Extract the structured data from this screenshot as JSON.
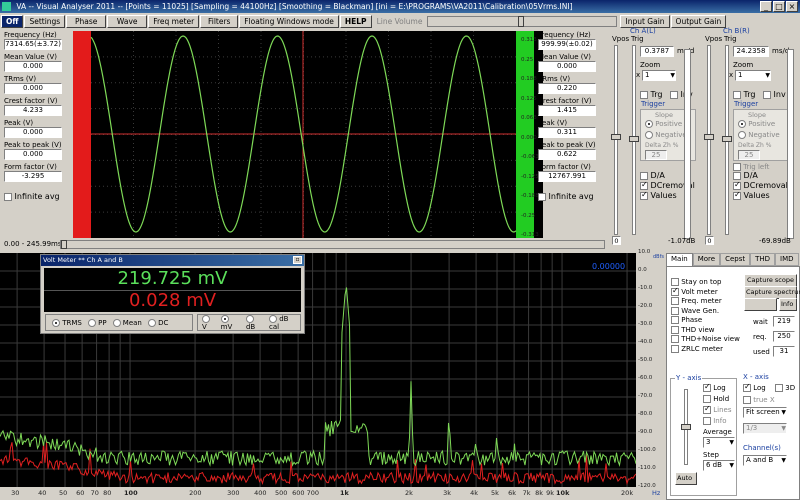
{
  "title_bar": {
    "text": "VA -- Visual Analyser 2011 --   [Points = 11025]   [Sampling = 44100Hz]   [Smoothing = Blackman]   [ini = E:\\PROGRAMS\\VA2011\\Calibration\\05Vrms.INI]"
  },
  "toolbar": {
    "off": "Off",
    "settings": "Settings",
    "phase": "Phase",
    "wave": "Wave",
    "freq_meter": "Freq meter",
    "filters": "Filters",
    "floating": "Floating Windows mode",
    "help": "HELP",
    "line_volume": "Line Volume",
    "input_gain": "Input Gain",
    "output_gain": "Output Gain"
  },
  "left_panel": {
    "frequency_label": "Frequency (Hz)",
    "frequency_value": "7314.65(±3.72)",
    "mean_label": "Mean Value (V)",
    "mean_value": "0.000",
    "trms_label": "TRms (V)",
    "trms_value": "0.000",
    "crest_label": "Crest factor (V)",
    "crest_value": "4.233",
    "peak_label": "Peak (V)",
    "peak_value": "0.000",
    "p2p_label": "Peak to peak (V)",
    "p2p_value": "0.000",
    "form_label": "Form factor (V)",
    "form_value": "-3.295",
    "infinite_avg": "Infinite avg"
  },
  "right_panel": {
    "frequency_label": "Frequency (Hz)",
    "frequency_value": "999.99(±0.02)",
    "mean_label": "Mean Value (V)",
    "mean_value": "0.000",
    "trms_label": "TRms (V)",
    "trms_value": "0.220",
    "crest_label": "Crest factor (V)",
    "crest_value": "1.415",
    "peak_label": "Peak (V)",
    "peak_value": "0.311",
    "p2p_label": "Peak to peak (V)",
    "p2p_value": "0.622",
    "form_label": "Form factor (V)",
    "form_value": "12767.991",
    "infinite_avg": "Infinite avg"
  },
  "scope": {
    "ticks": [
      "0.313",
      "0.25",
      "0.188",
      "0.125",
      "0.063",
      "0.000",
      "-0.063",
      "-0.125",
      "-0.188",
      "-0.25",
      "-0.313"
    ],
    "time_range": "0.00 - 245.99ms"
  },
  "channel_a": {
    "title": "Ch A(L)",
    "vpos": "Vpos",
    "trig": "Trig",
    "ms_div_value": "0.3787",
    "ms_div_unit": "ms/d",
    "zoom_label": "Zoom",
    "zoom_value": "1",
    "zoom_unit": "x",
    "trg": "Trg",
    "inv": "Inv",
    "trigger": "Trigger",
    "slope": "Slope",
    "positive": "Positive",
    "negative": "Negative",
    "delta": "Delta Zh %",
    "delta_value": "25",
    "da": "D/A",
    "dcremoval": "DCremoval",
    "values": "Values",
    "zero": "0",
    "db": "-1.07dB"
  },
  "channel_b": {
    "title": "Ch B(R)",
    "vpos": "Vpos",
    "trig": "Trig",
    "ms_div_value": "24.2358",
    "ms_div_unit": "ms/d",
    "zoom_label": "Zoom",
    "zoom_value": "1",
    "zoom_unit": "x",
    "trg": "Trg",
    "inv": "Inv",
    "trigger": "Trigger",
    "slope": "Slope",
    "positive": "Positive",
    "negative": "Negative",
    "trig_left": "Trig left",
    "delta": "Delta Zh %",
    "delta_value": "25",
    "da": "D/A",
    "dcremoval": "DCremoval",
    "values": "Values",
    "zero": "0",
    "db": "-69.89dB"
  },
  "voltmeter": {
    "title": "Volt Meter ** Ch A and B",
    "value_a": "219.725 mV",
    "value_b": "0.028 mV",
    "modes": [
      "TRMS",
      "PP",
      "Mean",
      "DC"
    ],
    "units": [
      "V",
      "mV",
      "dB",
      "dB cal"
    ]
  },
  "spectrum": {
    "readout": "0.00000",
    "db_ticks": [
      "10.0",
      "0.0",
      "-10.0",
      "-20.0",
      "-30.0",
      "-40.0",
      "-50.0",
      "-60.0",
      "-70.0",
      "-80.0",
      "-90.0",
      "-100.0",
      "-110.0",
      "-120.0"
    ],
    "freq_ticks": [
      "30",
      "40",
      "50",
      "60",
      "70",
      "80",
      "100",
      "200",
      "300",
      "400",
      "500",
      "600",
      "700",
      "1k",
      "2k",
      "3k",
      "4k",
      "5k",
      "6k",
      "7k",
      "8k",
      "9k",
      "10k",
      "20k"
    ],
    "db_unit": "dBfs",
    "hz_unit": "Hz"
  },
  "side_tabs": [
    "Main",
    "More",
    "Cepst",
    "THD",
    "IMD"
  ],
  "main_tab": {
    "checkboxes": [
      {
        "label": "Stay on top",
        "on": false
      },
      {
        "label": "Volt meter",
        "on": true
      },
      {
        "label": "Freq. meter",
        "on": false
      },
      {
        "label": "Wave Gen.",
        "on": false
      },
      {
        "label": "Phase",
        "on": false
      },
      {
        "label": "THD view",
        "on": false
      },
      {
        "label": "THD+Noise view",
        "on": false
      },
      {
        "label": "ZRLC meter",
        "on": false
      }
    ],
    "capture_scope": "Capture scope",
    "capture_spectrum": "Capture spectrum",
    "info": "Info",
    "wait_label": "wait",
    "wait_value": "219",
    "req_label": "req.",
    "req_value": "250",
    "used_label": "used",
    "used_value": "31",
    "y_axis": "Y - axis",
    "y_log": "Log",
    "y_hold": "Hold",
    "y_lines": "Lines",
    "y_info": "Info",
    "average_label": "Average",
    "average_value": "3",
    "step_label": "Step",
    "step_value": "6 dB",
    "auto": "Auto",
    "x_axis": "X - axis",
    "x_log": "Log",
    "x_3d": "3D",
    "x_true": "true X",
    "fit_screen": "Fit screen",
    "ratio": "1/3",
    "channels_label": "Channel(s)",
    "channels_value": "A and B"
  },
  "colors": {
    "trace_a": "#7ed957",
    "trace_b": "#e02020",
    "scope_bg": "#000000",
    "grid": "#404040",
    "voltmeter_a": "#5be05b",
    "voltmeter_b": "#e02020"
  }
}
